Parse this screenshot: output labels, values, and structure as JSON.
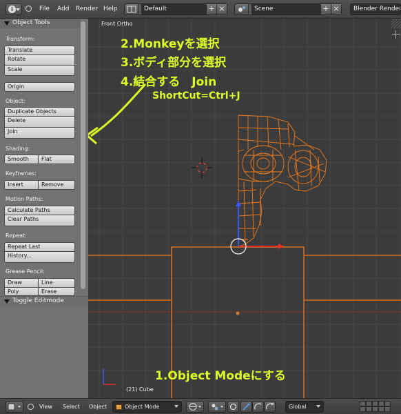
{
  "topbar": {
    "menus": [
      "File",
      "Add",
      "Render",
      "Help"
    ],
    "screen_layout": "Default",
    "scene": "Scene",
    "render_engine": "Blender Render",
    "add_symbol": "+",
    "close_symbol": "×"
  },
  "tool_shelf": {
    "title": "Object Tools",
    "sections": {
      "transform": {
        "label": "Transform:",
        "buttons": [
          "Translate",
          "Rotate",
          "Scale"
        ]
      },
      "origin": {
        "button": "Origin"
      },
      "object": {
        "label": "Object:",
        "buttons": [
          "Duplicate Objects",
          "Delete",
          "Join"
        ]
      },
      "shading": {
        "label": "Shading:",
        "buttons": [
          "Smooth",
          "Flat"
        ]
      },
      "keyframes": {
        "label": "Keyframes:",
        "buttons": [
          "Insert",
          "Remove"
        ]
      },
      "motion_paths": {
        "label": "Motion Paths:",
        "buttons": [
          "Calculate Paths",
          "Clear Paths"
        ]
      },
      "repeat": {
        "label": "Repeat:",
        "buttons": [
          "Repeat Last",
          "History..."
        ]
      },
      "grease_pencil": {
        "label": "Grease Pencil:",
        "buttons": [
          "Draw",
          "Line",
          "Poly",
          "Erase"
        ]
      }
    },
    "operator_panel": "Toggle Editmode"
  },
  "viewport": {
    "view_name": "Front Ortho",
    "active_object": "(21) Cube",
    "annotations": {
      "step2": "2.Monkeyを選択",
      "step3": "3.ボディ部分を選択",
      "step4": "4.結合する　Join",
      "shortcut": "ShortCut=Ctrl+J",
      "step1": "1.Object Modeにする"
    },
    "colors": {
      "background": "#3b3b3b",
      "selection": "#f07a1a",
      "annotation": "#d9ff28",
      "x_axis": "#e8302a",
      "z_axis": "#3a56ff"
    }
  },
  "bottombar": {
    "menus": [
      "View",
      "Select",
      "Object"
    ],
    "mode": "Object Mode",
    "orientation": "Global"
  }
}
